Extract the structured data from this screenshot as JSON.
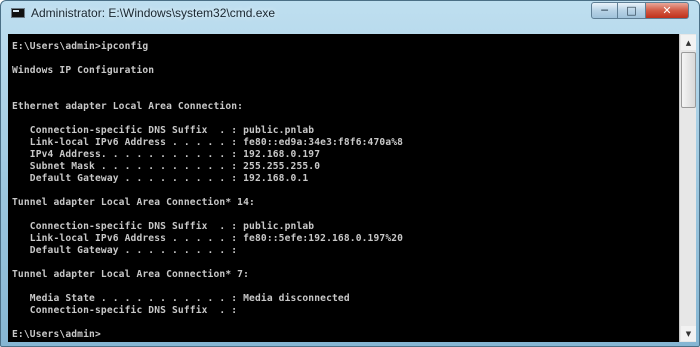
{
  "window": {
    "title": "Administrator: E:\\Windows\\system32\\cmd.exe",
    "icon": "cmd-icon",
    "controls": {
      "minimize": "─",
      "maximize": "□",
      "close": "✕"
    }
  },
  "console": {
    "lines": [
      "E:\\Users\\admin>ipconfig",
      "",
      "Windows IP Configuration",
      "",
      "",
      "Ethernet adapter Local Area Connection:",
      "",
      "   Connection-specific DNS Suffix  . : public.pnlab",
      "   Link-local IPv6 Address . . . . . : fe80::ed9a:34e3:f8f6:470a%8",
      "   IPv4 Address. . . . . . . . . . . : 192.168.0.197",
      "   Subnet Mask . . . . . . . . . . . : 255.255.255.0",
      "   Default Gateway . . . . . . . . . : 192.168.0.1",
      "",
      "Tunnel adapter Local Area Connection* 14:",
      "",
      "   Connection-specific DNS Suffix  . : public.pnlab",
      "   Link-local IPv6 Address . . . . . : fe80::5efe:192.168.0.197%20",
      "   Default Gateway . . . . . . . . . :",
      "",
      "Tunnel adapter Local Area Connection* 7:",
      "",
      "   Media State . . . . . . . . . . . : Media disconnected",
      "   Connection-specific DNS Suffix  . :",
      "",
      "E:\\Users\\admin>"
    ]
  },
  "scrollbar": {
    "up_arrow": "▲",
    "down_arrow": "▼"
  },
  "colors": {
    "console_bg": "#000000",
    "console_text": "#c0c0c0"
  }
}
